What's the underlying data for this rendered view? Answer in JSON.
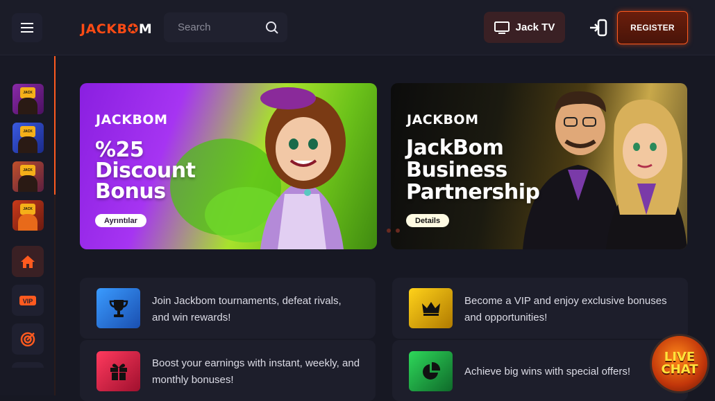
{
  "header": {
    "logo_left": "JACKB",
    "logo_mid": "✪",
    "logo_right": "M",
    "search_placeholder": "Search",
    "jacktv_label": "Jack TV",
    "register_label": "REGISTER"
  },
  "sidebar": {
    "thumbs": [
      {
        "badge": "JACK",
        "bg": "#6c1e8a"
      },
      {
        "badge": "JACK",
        "bg": "#2a3fb0"
      },
      {
        "badge": "JACK",
        "bg": "#8a3a22"
      },
      {
        "badge": "JACK",
        "bg": "#a8281a"
      }
    ],
    "vip_label": "VIP"
  },
  "banners": [
    {
      "logo": "JACKBOM",
      "headline": "%25\nDiscount\nBonus",
      "button": "Ayrıntılar"
    },
    {
      "logo": "JACKBOM",
      "headline": "JackBom\nBusiness\nPartnership",
      "button": "Details"
    }
  ],
  "cards": [
    {
      "text": "Join Jackbom tournaments, defeat rivals, and win rewards!",
      "icon": "trophy-icon",
      "color": "#2a7fe0"
    },
    {
      "text": "Become a VIP and enjoy exclusive bonuses and opportunities!",
      "icon": "crown-icon",
      "color": "#e6b400"
    },
    {
      "text": "Boost your earnings with instant, weekly, and monthly bonuses!",
      "icon": "gift-icon",
      "color": "#d4204a"
    },
    {
      "text": "Achieve big wins with special offers!",
      "icon": "pie-chart-icon",
      "color": "#1fa84a"
    }
  ],
  "livechat": {
    "line1": "LIVE",
    "line2": "CHAT"
  },
  "colors": {
    "accent": "#ff5a1f",
    "background": "#171823"
  }
}
